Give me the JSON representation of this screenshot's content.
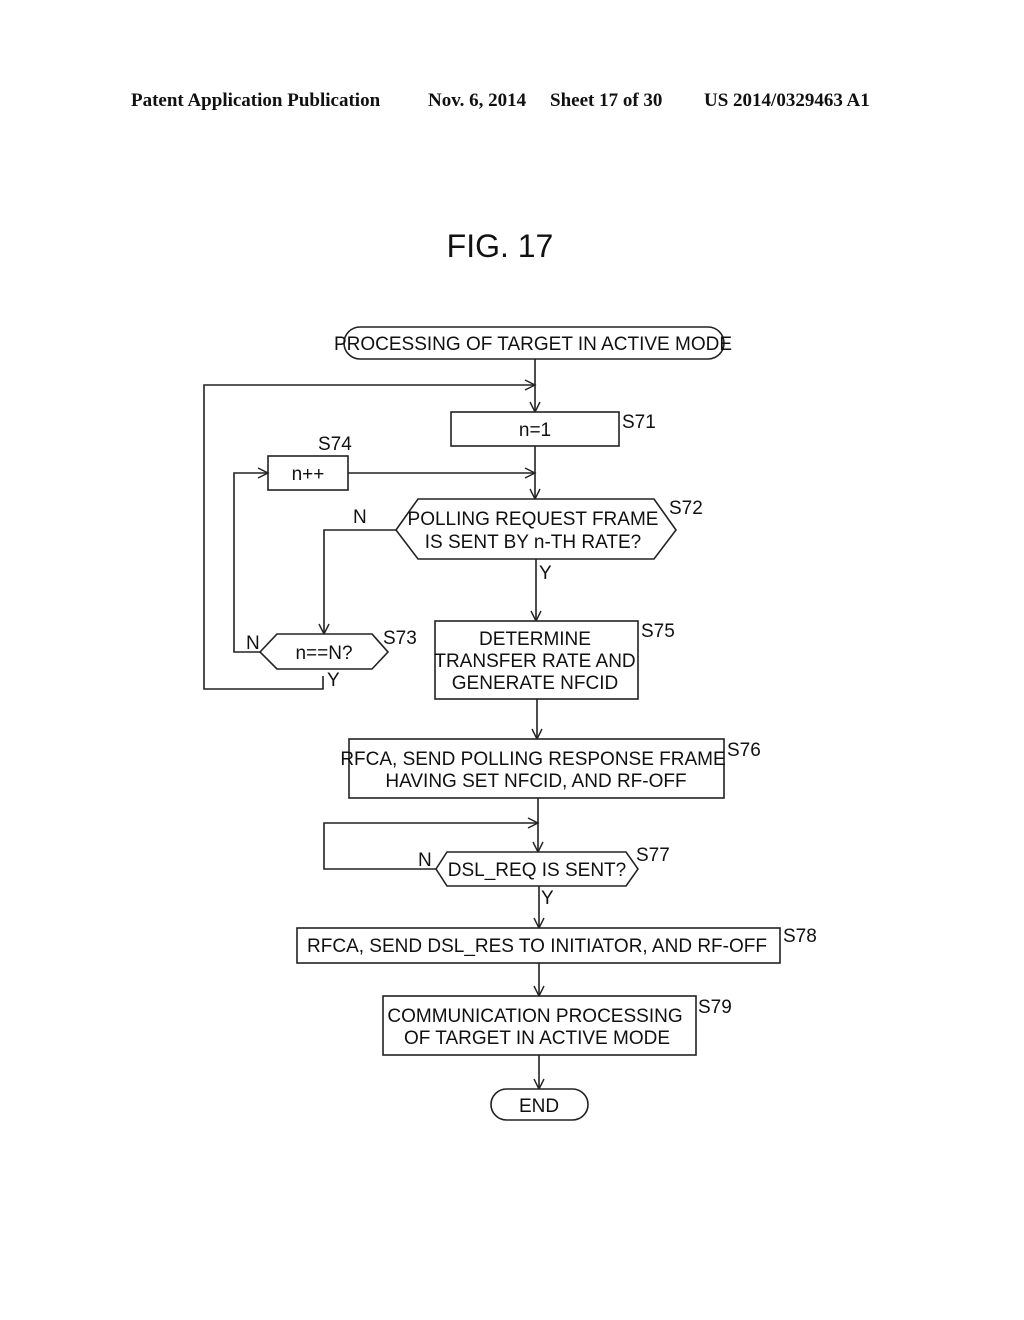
{
  "header": {
    "publication": "Patent Application Publication",
    "date": "Nov. 6, 2014",
    "sheet": "Sheet 17 of 30",
    "number": "US 2014/0329463 A1"
  },
  "figure": {
    "title": "FIG. 17",
    "start": "PROCESSING OF TARGET IN ACTIVE MODE",
    "end": "END",
    "steps": {
      "s71": {
        "label": "S71",
        "text": "n=1"
      },
      "s72": {
        "label": "S72",
        "line1": "POLLING REQUEST FRAME",
        "line2": "IS SENT BY n-TH RATE?"
      },
      "s73": {
        "label": "S73",
        "text": "n==N?"
      },
      "s74": {
        "label": "S74",
        "text": "n++"
      },
      "s75": {
        "label": "S75",
        "line1": "DETERMINE",
        "line2": "TRANSFER RATE AND",
        "line3": "GENERATE NFCID"
      },
      "s76": {
        "label": "S76",
        "line1": "RFCA, SEND POLLING RESPONSE FRAME",
        "line2": "HAVING SET NFCID, AND RF-OFF"
      },
      "s77": {
        "label": "S77",
        "text": "DSL_REQ IS SENT?"
      },
      "s78": {
        "label": "S78",
        "text": "RFCA, SEND DSL_RES TO INITIATOR, AND RF-OFF"
      },
      "s79": {
        "label": "S79",
        "line1": "COMMUNICATION PROCESSING",
        "line2": "OF TARGET IN ACTIVE MODE"
      }
    },
    "branches": {
      "yes": "Y",
      "no": "N"
    }
  }
}
